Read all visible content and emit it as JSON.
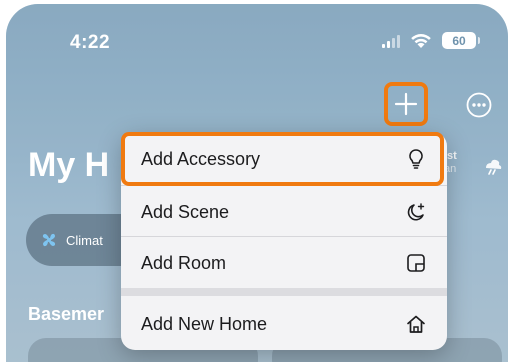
{
  "status_bar": {
    "time": "4:22",
    "battery": "60"
  },
  "header": {
    "title": "My H",
    "location_top": "ist",
    "location_sub": "an"
  },
  "chips": {
    "climate_label": "Climat"
  },
  "section": {
    "basement_label": "Basemer"
  },
  "menu": {
    "items": [
      {
        "label": "Add Accessory",
        "icon": "lightbulb-icon"
      },
      {
        "label": "Add Scene",
        "icon": "moon-sparkle-icon"
      },
      {
        "label": "Add Room",
        "icon": "room-icon"
      },
      {
        "label": "Add New Home",
        "icon": "house-icon"
      }
    ]
  },
  "colors": {
    "highlight": "#f07a10",
    "menu_bg": "#f3f3f5",
    "text": "#1c1c1e"
  }
}
